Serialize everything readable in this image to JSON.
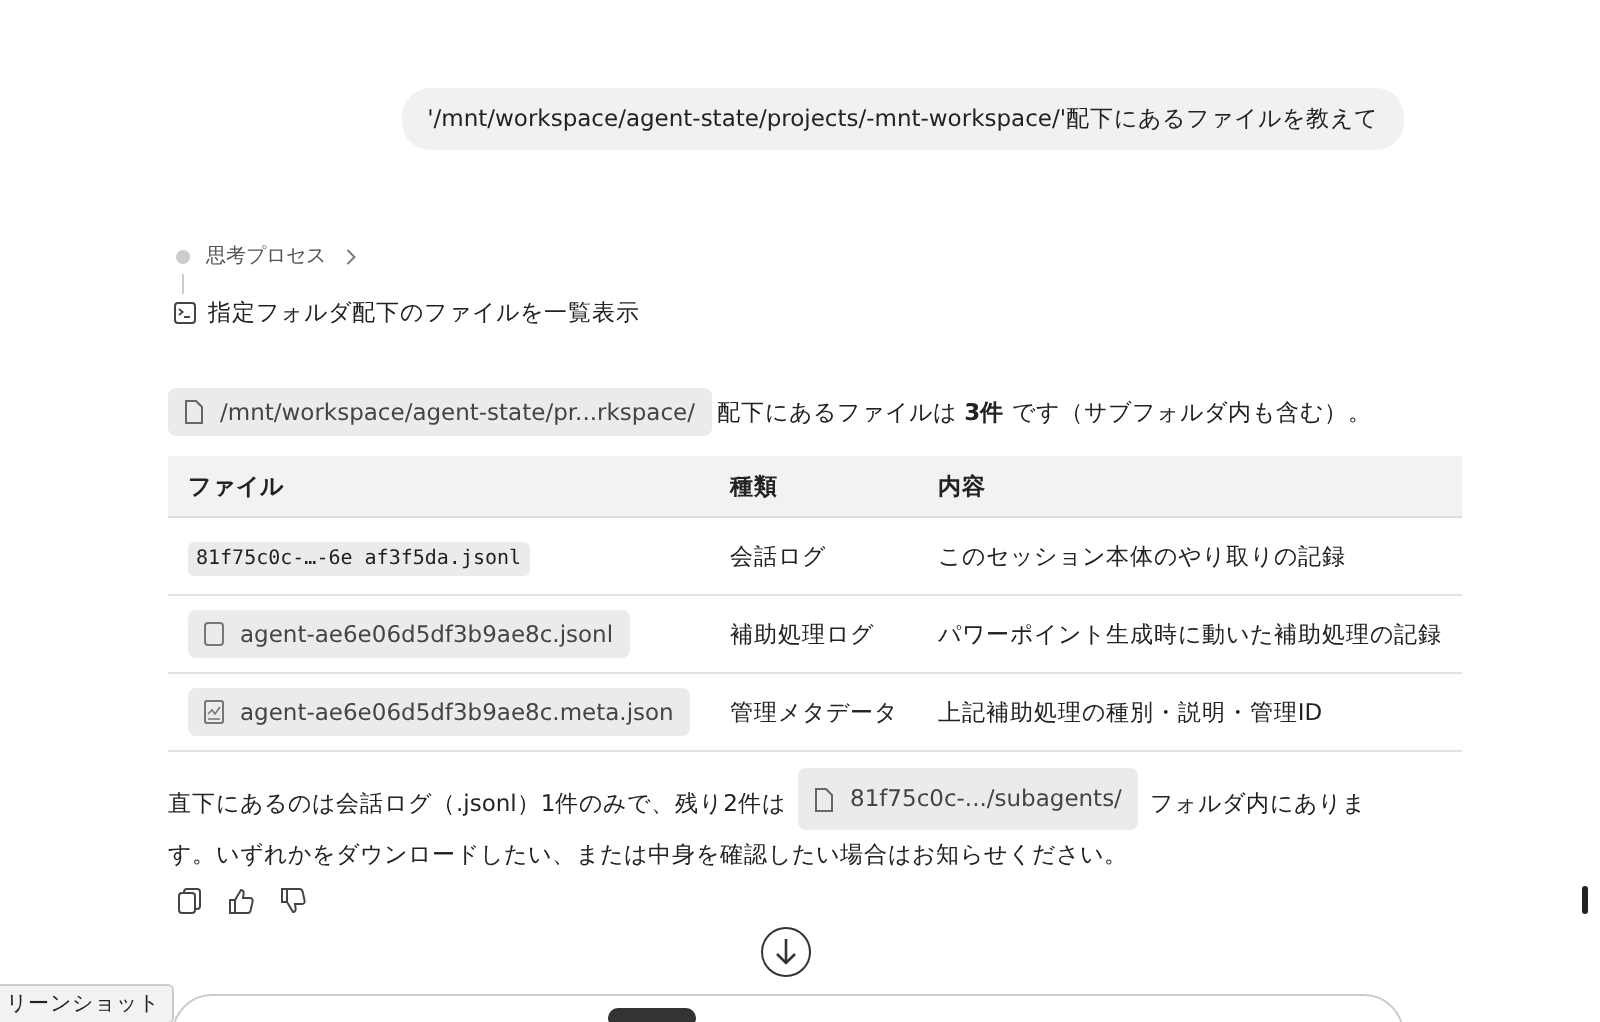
{
  "user_message": "'/mnt/workspace/agent-state/projects/-mnt-workspace/'配下にあるファイルを教えて",
  "thinking": {
    "label": "思考プロセス",
    "expanded": false,
    "step": "指定フォルダ配下のファイルを一覧表示"
  },
  "summary": {
    "chip": "/mnt/workspace/agent-state/pr...rkspace/",
    "text": "配下にあるファイルは **3件** です（サブフォルダ内も含む）。"
  },
  "table": {
    "columns": [
      "ファイル",
      "種類",
      "内容"
    ],
    "rows": [
      {
        "kind": "code",
        "file": "81f75c0c-…-6e af3f5da.jsonl",
        "type": "会話ログ",
        "content": "このセッション本体のやり取りの記録"
      },
      {
        "kind": "doc",
        "file": "agent-ae6e06d5df3b9ae8c.jsonl",
        "type": "補助処理ログ",
        "content": "パワーポイント生成時に動いた補助処理の記録"
      },
      {
        "kind": "chart",
        "file": "agent-ae6e06d5df3b9ae8c.meta.json",
        "type": "管理メタデータ",
        "content": "上記補助処理の種別・説明・管理ID"
      }
    ]
  },
  "closing": {
    "before": "直下にあるのは会話ログ（.jsonl）1件のみで、残り2件は",
    "chip": "81f75c0c-.../subagents/",
    "after": "フォルダ内にあります。いずれかをダウンロードしたい、または中身を確認したい場合はお知らせください。"
  },
  "side_tab": "リーンショット"
}
